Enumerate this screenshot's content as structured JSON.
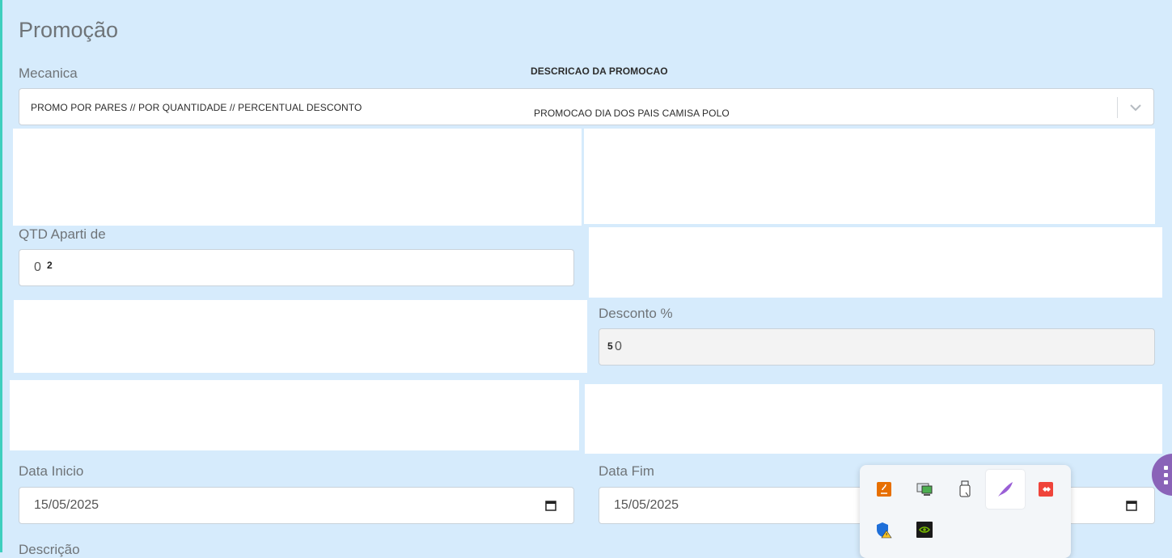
{
  "page_title": "Promoção",
  "mecanica": {
    "label": "Mecanica",
    "value": "PROMO POR PARES // POR QUANTIDADE   // PERCENTUAL DESCONTO",
    "toggle_icon": "chevron-down-icon"
  },
  "descricao_promocao": {
    "label": "DESCRICAO DA PROMOCAO",
    "value": "PROMOCAO DIA DOS PAIS CAMISA POLO"
  },
  "qtd": {
    "label": "QTD Aparti de",
    "value": "0",
    "overlay": "2"
  },
  "desconto": {
    "label": "Desconto %",
    "value": "0",
    "overlay": "5"
  },
  "data_inicio": {
    "label": "Data Inicio",
    "value": "15/05/2025"
  },
  "data_fim": {
    "label": "Data Fim",
    "value": "15/05/2025"
  },
  "descricao_label": "Descrição",
  "tray": {
    "icons": [
      "java-icon",
      "network-monitor-icon",
      "usb-drive-icon",
      "feather-icon",
      "anydesk-icon",
      "defender-warning-icon",
      "nvidia-icon"
    ]
  },
  "colors": {
    "background": "#d6ebfc",
    "accent": "#3ecfbe",
    "fab": "#8a63b8"
  }
}
